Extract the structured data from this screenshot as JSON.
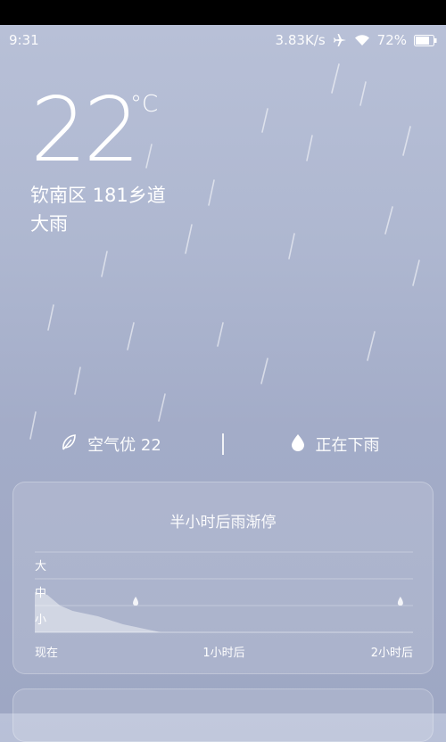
{
  "status_bar": {
    "time": "9:31",
    "net_speed": "3.83K/s",
    "battery": "72%",
    "icons": [
      "airplane-icon",
      "wifi-icon",
      "battery-icon"
    ]
  },
  "weather": {
    "temperature": "22",
    "unit": "°C",
    "location": "钦南区  181乡道",
    "condition": "大雨"
  },
  "metrics": {
    "air_quality": "空气优 22",
    "rain_status": "正在下雨",
    "icons": [
      "leaf-icon",
      "raindrop-icon"
    ]
  },
  "precip_card": {
    "title": "半小时后雨渐停",
    "levels": [
      "大",
      "中",
      "小"
    ],
    "time_labels": [
      "现在",
      "1小时后",
      "2小时后"
    ]
  },
  "chart_data": {
    "type": "area",
    "x_labels": [
      "现在",
      "1小时后",
      "2小时后"
    ],
    "y_levels": [
      "小",
      "中",
      "大"
    ],
    "x": [
      0,
      4,
      8,
      12,
      16,
      20,
      24,
      28,
      32,
      36,
      40,
      120
    ],
    "values": [
      1.5,
      1.4,
      1.0,
      0.8,
      0.7,
      0.6,
      0.45,
      0.3,
      0.2,
      0.1,
      0,
      0
    ],
    "ylim": [
      0,
      3
    ],
    "xlim": [
      0,
      120
    ],
    "grid": true,
    "drop_markers_x": [
      32,
      116
    ]
  },
  "colors": {
    "bg_top": "#b9c1d8",
    "bg_bottom": "#9ea7c4",
    "text": "#ffffff"
  }
}
